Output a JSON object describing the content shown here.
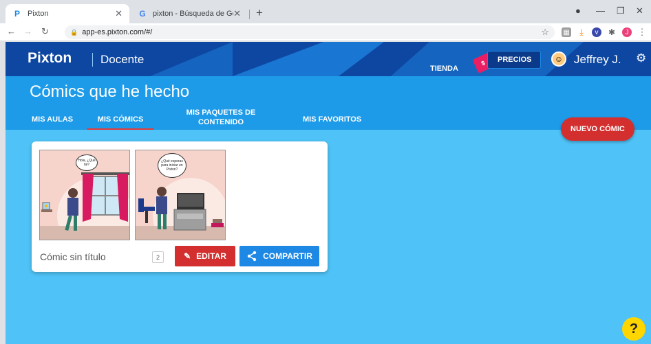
{
  "browser": {
    "tabs": [
      {
        "title": "Pixton",
        "active": true,
        "favicon": "pixton-icon"
      },
      {
        "title": "pixton - Búsqueda de Google",
        "active": false,
        "favicon": "google-icon"
      }
    ],
    "url": "app-es.pixton.com/#/"
  },
  "header": {
    "logo": "Pixton",
    "role": "Docente",
    "store_label": "TIENDA",
    "prices_label": "PRECIOS",
    "user_name": "Jeffrey J."
  },
  "subheader": {
    "title": "Cómics que he hecho",
    "tabs": [
      {
        "label": "MIS AULAS"
      },
      {
        "label": "MIS CÓMICS",
        "active": true
      },
      {
        "label": "MIS PAQUETES DE CONTENIDO"
      },
      {
        "label": "MIS FAVORITOS"
      }
    ],
    "new_comic_label": "NUEVO CÓMIC"
  },
  "comic_card": {
    "panels": [
      {
        "bubble": "Hola, ¿Qué tal?"
      },
      {
        "bubble": "¿Qué esperas para iniciar en Pixton?"
      }
    ],
    "title": "Cómic sin título",
    "panel_count": "2",
    "edit_label": "EDITAR",
    "share_label": "COMPARTIR"
  },
  "help_label": "?",
  "colors": {
    "header_bg": "#0d47a1",
    "subheader_bg": "#1e9be8",
    "main_bg": "#4fc3f7",
    "edit_red": "#d32f2f",
    "share_blue": "#1e88e5",
    "help_yellow": "#ffd600"
  }
}
